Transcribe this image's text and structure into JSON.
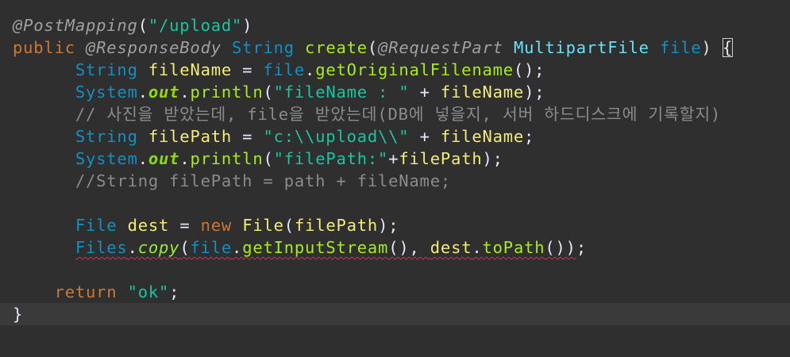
{
  "editor": {
    "language": "java",
    "current_line_index": 13,
    "colors": {
      "background": "#2f2f2f",
      "current_line": "#3a3a3a",
      "annotation": "#a0a0a0",
      "keyword": "#cc7832",
      "type": "#1290c3",
      "method": "#a7ec21",
      "variable": "#f3ec79",
      "parameter": "#66e1f8",
      "string": "#17c6a3",
      "comment": "#8b8b8b",
      "error_underline": "#d62d5b"
    },
    "lines": [
      [
        {
          "t": "@PostMapping",
          "c": "ann"
        },
        {
          "t": "(",
          "c": "plain"
        },
        {
          "t": "\"/upload\"",
          "c": "str"
        },
        {
          "t": ")",
          "c": "plain"
        }
      ],
      [
        {
          "t": "public",
          "c": "kw"
        },
        {
          "t": " ",
          "c": "plain"
        },
        {
          "t": "@ResponseBody",
          "c": "ann"
        },
        {
          "t": " ",
          "c": "plain"
        },
        {
          "t": "String",
          "c": "type"
        },
        {
          "t": " ",
          "c": "plain"
        },
        {
          "t": "create",
          "c": "fn"
        },
        {
          "t": "(",
          "c": "plain"
        },
        {
          "t": "@RequestPart",
          "c": "ann"
        },
        {
          "t": " ",
          "c": "plain"
        },
        {
          "t": "MultipartFile",
          "c": "param"
        },
        {
          "t": " ",
          "c": "plain"
        },
        {
          "t": "file",
          "c": "type"
        },
        {
          "t": ") ",
          "c": "plain"
        },
        {
          "t": "{",
          "c": "plain",
          "hl": true
        }
      ],
      [
        {
          "t": "      ",
          "c": "plain"
        },
        {
          "t": "String",
          "c": "type"
        },
        {
          "t": " ",
          "c": "plain"
        },
        {
          "t": "fileName",
          "c": "var"
        },
        {
          "t": " = ",
          "c": "plain"
        },
        {
          "t": "file",
          "c": "type"
        },
        {
          "t": ".",
          "c": "plain"
        },
        {
          "t": "getOriginalFilename",
          "c": "fn"
        },
        {
          "t": "();",
          "c": "plain"
        }
      ],
      [
        {
          "t": "      ",
          "c": "plain"
        },
        {
          "t": "System",
          "c": "type"
        },
        {
          "t": ".",
          "c": "plain"
        },
        {
          "t": "out",
          "c": "field"
        },
        {
          "t": ".",
          "c": "plain"
        },
        {
          "t": "println",
          "c": "fn"
        },
        {
          "t": "(",
          "c": "plain"
        },
        {
          "t": "\"fileName : \"",
          "c": "str"
        },
        {
          "t": " + ",
          "c": "plain"
        },
        {
          "t": "fileName",
          "c": "var"
        },
        {
          "t": ");",
          "c": "plain"
        }
      ],
      [
        {
          "t": "      ",
          "c": "plain"
        },
        {
          "t": "// 사진을 받았는데, file을 받았는데(DB에 넣을지, 서버 하드디스크에 기록할지)",
          "c": "cmt"
        }
      ],
      [
        {
          "t": "      ",
          "c": "plain"
        },
        {
          "t": "String",
          "c": "type"
        },
        {
          "t": " ",
          "c": "plain"
        },
        {
          "t": "filePath",
          "c": "var"
        },
        {
          "t": " = ",
          "c": "plain"
        },
        {
          "t": "\"c:\\\\upload\\\\\"",
          "c": "str"
        },
        {
          "t": " + ",
          "c": "plain"
        },
        {
          "t": "fileName",
          "c": "var"
        },
        {
          "t": ";",
          "c": "plain"
        }
      ],
      [
        {
          "t": "      ",
          "c": "plain"
        },
        {
          "t": "System",
          "c": "type"
        },
        {
          "t": ".",
          "c": "plain"
        },
        {
          "t": "out",
          "c": "field"
        },
        {
          "t": ".",
          "c": "plain"
        },
        {
          "t": "println",
          "c": "fn"
        },
        {
          "t": "(",
          "c": "plain"
        },
        {
          "t": "\"filePath:\"",
          "c": "str"
        },
        {
          "t": "+",
          "c": "plain"
        },
        {
          "t": "filePath",
          "c": "var"
        },
        {
          "t": ");",
          "c": "plain"
        }
      ],
      [
        {
          "t": "      ",
          "c": "plain"
        },
        {
          "t": "//String filePath = path + fileName;",
          "c": "cmt"
        }
      ],
      [],
      [
        {
          "t": "      ",
          "c": "plain"
        },
        {
          "t": "File",
          "c": "type"
        },
        {
          "t": " ",
          "c": "plain"
        },
        {
          "t": "dest",
          "c": "var"
        },
        {
          "t": " = ",
          "c": "plain"
        },
        {
          "t": "new",
          "c": "kw"
        },
        {
          "t": " ",
          "c": "plain"
        },
        {
          "t": "File",
          "c": "var"
        },
        {
          "t": "(",
          "c": "plain"
        },
        {
          "t": "filePath",
          "c": "var"
        },
        {
          "t": ");",
          "c": "plain"
        }
      ],
      [
        {
          "t": "      ",
          "c": "plain"
        },
        {
          "t": "Files",
          "c": "type",
          "err": true
        },
        {
          "t": ".",
          "c": "plain",
          "err": true
        },
        {
          "t": "copy",
          "c": "sfn",
          "err": true
        },
        {
          "t": "(",
          "c": "plain",
          "err": true
        },
        {
          "t": "file",
          "c": "type",
          "err": true
        },
        {
          "t": ".",
          "c": "plain",
          "err": true
        },
        {
          "t": "getInputStream",
          "c": "fn",
          "err": true
        },
        {
          "t": "(), ",
          "c": "plain",
          "err": true
        },
        {
          "t": "dest",
          "c": "var",
          "err": true
        },
        {
          "t": ".",
          "c": "plain",
          "err": true
        },
        {
          "t": "toPath",
          "c": "fn",
          "err": true
        },
        {
          "t": "())",
          "c": "plain",
          "err": true
        },
        {
          "t": ";",
          "c": "plain"
        }
      ],
      [],
      [
        {
          "t": "    ",
          "c": "plain"
        },
        {
          "t": "return",
          "c": "kw"
        },
        {
          "t": " ",
          "c": "plain"
        },
        {
          "t": "\"ok\"",
          "c": "str"
        },
        {
          "t": ";",
          "c": "plain"
        }
      ],
      [
        {
          "t": "}",
          "c": "plain"
        }
      ]
    ]
  }
}
